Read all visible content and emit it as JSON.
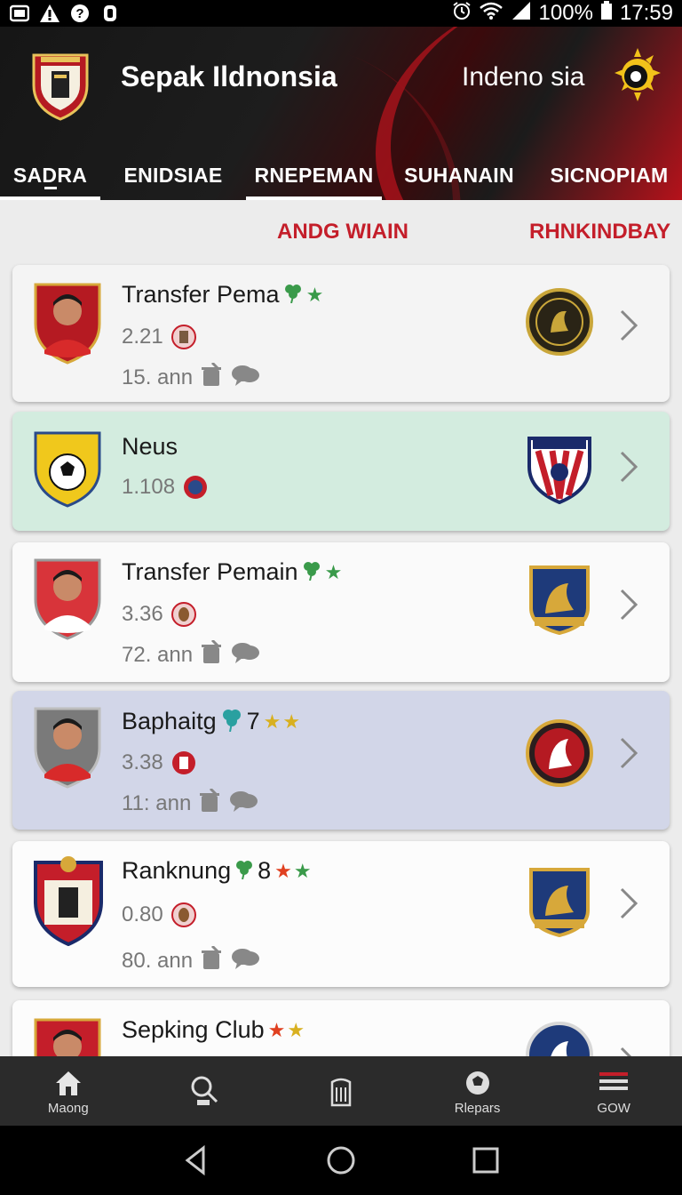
{
  "status_bar": {
    "battery": "100%",
    "time": "17:59",
    "left_icons": [
      "image-icon",
      "warning-icon",
      "question-icon",
      "voicemail-icon"
    ],
    "right_icons": [
      "alarm-icon",
      "wifi-icon",
      "signal-icon",
      "battery-icon"
    ]
  },
  "header": {
    "app_title": "Sepak Ildnonsia",
    "region": "Indeno sia",
    "colors": {
      "accent": "#c41e2a",
      "dark": "#1b1b1b"
    }
  },
  "tabs": [
    {
      "label": "SADRA",
      "active": true
    },
    {
      "label": "ENIDSIAE",
      "active": false
    },
    {
      "label": "RNEPEMAN",
      "active": true
    },
    {
      "label": "SUHANAIN",
      "active": false
    },
    {
      "label": "SICNOPIAM",
      "active": false
    }
  ],
  "filters": {
    "left": "ANDG WIAIN",
    "right": "RHNKINDBAY"
  },
  "list": [
    {
      "title": "Transfer Pema",
      "num": "2.21",
      "time": "15. ann",
      "bg": "#f4f4f4",
      "tag": "",
      "star_colors": [
        "#3a9a4a"
      ]
    },
    {
      "title": "Neus",
      "num": "1.108",
      "time": "",
      "bg": "#d3ecdf",
      "tag": "",
      "star_colors": []
    },
    {
      "title": "Transfer Pemain",
      "num": "3.36",
      "time": "72. ann",
      "bg": "#fafafa",
      "tag": "",
      "star_colors": [
        "#3a9a4a"
      ]
    },
    {
      "title": "Baphaitg",
      "num": "3.38",
      "time": "11: ann",
      "bg": "#d2d6e8",
      "tag": "7",
      "star_colors": [
        "#d8b020",
        "#d8b020"
      ]
    },
    {
      "title": "Ranknung",
      "num": "0.80",
      "time": "80. ann",
      "bg": "#fcfcfc",
      "tag": "8",
      "star_colors": [
        "#e04020",
        "#3a9a4a"
      ]
    },
    {
      "title": "Sepking Club",
      "num": "",
      "time": "",
      "bg": "#fcfcfc",
      "tag": "",
      "star_colors": [
        "#e04020",
        "#d8b020"
      ]
    }
  ],
  "bottom_nav": [
    {
      "label": "Maong",
      "icon": "home-icon"
    },
    {
      "label": "",
      "icon": "search-icon"
    },
    {
      "label": "",
      "icon": "building-icon"
    },
    {
      "label": "Rlepars",
      "icon": "ball-icon"
    },
    {
      "label": "GOW",
      "icon": "menu-icon"
    }
  ]
}
